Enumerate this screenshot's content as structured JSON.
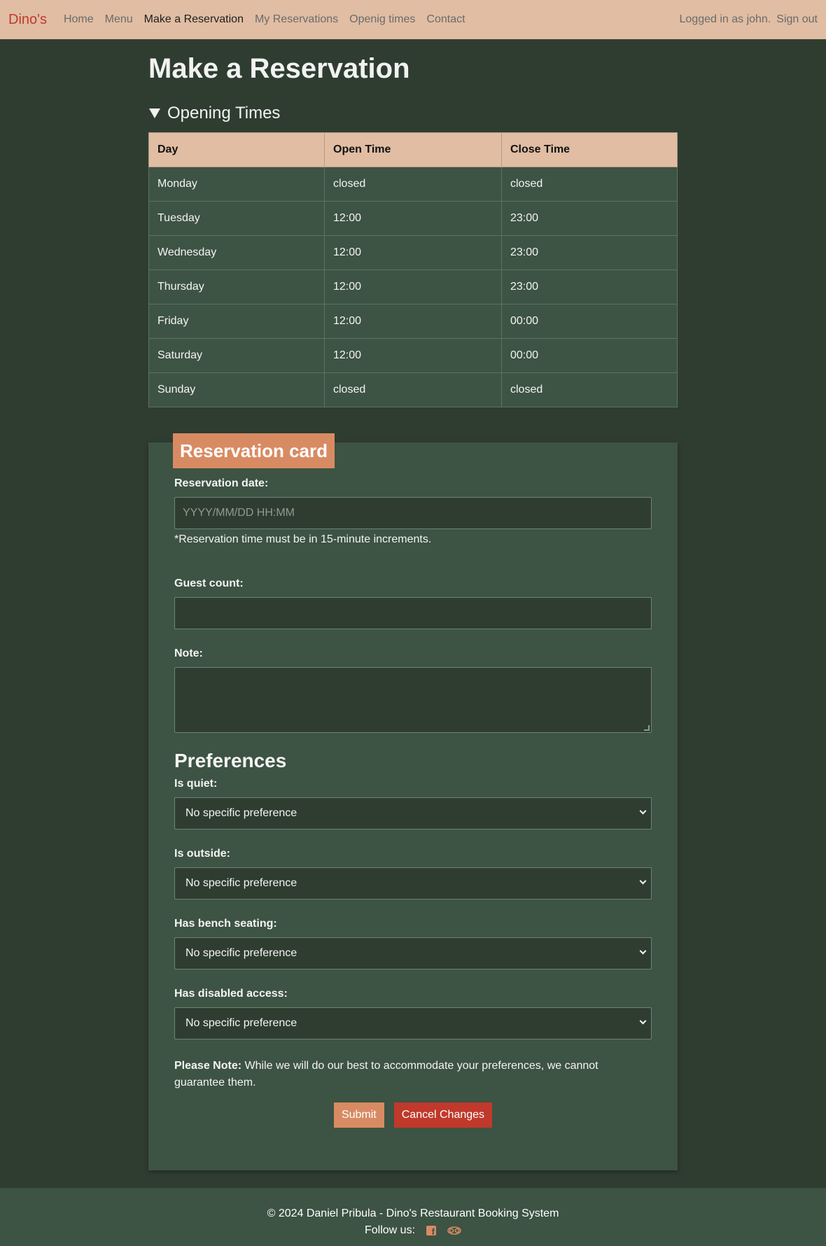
{
  "nav": {
    "brand": "Dino's",
    "links": [
      "Home",
      "Menu",
      "Make a Reservation",
      "My Reservations",
      "Openig times",
      "Contact"
    ],
    "logged_in": "Logged in as john.",
    "sign_out": "Sign out"
  },
  "page": {
    "title": "Make a Reservation",
    "opening_summary": "Opening Times"
  },
  "hours": {
    "headers": [
      "Day",
      "Open Time",
      "Close Time"
    ],
    "rows": [
      [
        "Monday",
        "closed",
        "closed"
      ],
      [
        "Tuesday",
        "12:00",
        "23:00"
      ],
      [
        "Wednesday",
        "12:00",
        "23:00"
      ],
      [
        "Thursday",
        "12:00",
        "23:00"
      ],
      [
        "Friday",
        "12:00",
        "00:00"
      ],
      [
        "Saturday",
        "12:00",
        "00:00"
      ],
      [
        "Sunday",
        "closed",
        "closed"
      ]
    ]
  },
  "card": {
    "legend": "Reservation card",
    "date_label": "Reservation date:",
    "date_placeholder": "YYYY/MM/DD HH:MM",
    "date_help": "*Reservation time must be in 15-minute increments.",
    "guest_label": "Guest count:",
    "note_label": "Note:",
    "preferences_title": "Preferences",
    "prefs": [
      {
        "label": "Is quiet:",
        "value": "No specific preference"
      },
      {
        "label": "Is outside:",
        "value": "No specific preference"
      },
      {
        "label": "Has bench seating:",
        "value": "No specific preference"
      },
      {
        "label": "Has disabled access:",
        "value": "No specific preference"
      }
    ],
    "note_bold": "Please Note:",
    "note_text": " While we will do our best to accommodate your preferences, we cannot guarantee them.",
    "submit": "Submit",
    "cancel": "Cancel Changes"
  },
  "footer": {
    "copyright": "© 2024 Daniel Pribula - Dino's Restaurant Booking System",
    "follow": "Follow us:",
    "icons": [
      "facebook-icon",
      "tripadvisor-icon"
    ]
  },
  "colors": {
    "navbar": "#e0bda3",
    "background": "#2f3d31",
    "card": "#3d5343",
    "accent": "#d88b63",
    "danger": "#c0392b"
  }
}
